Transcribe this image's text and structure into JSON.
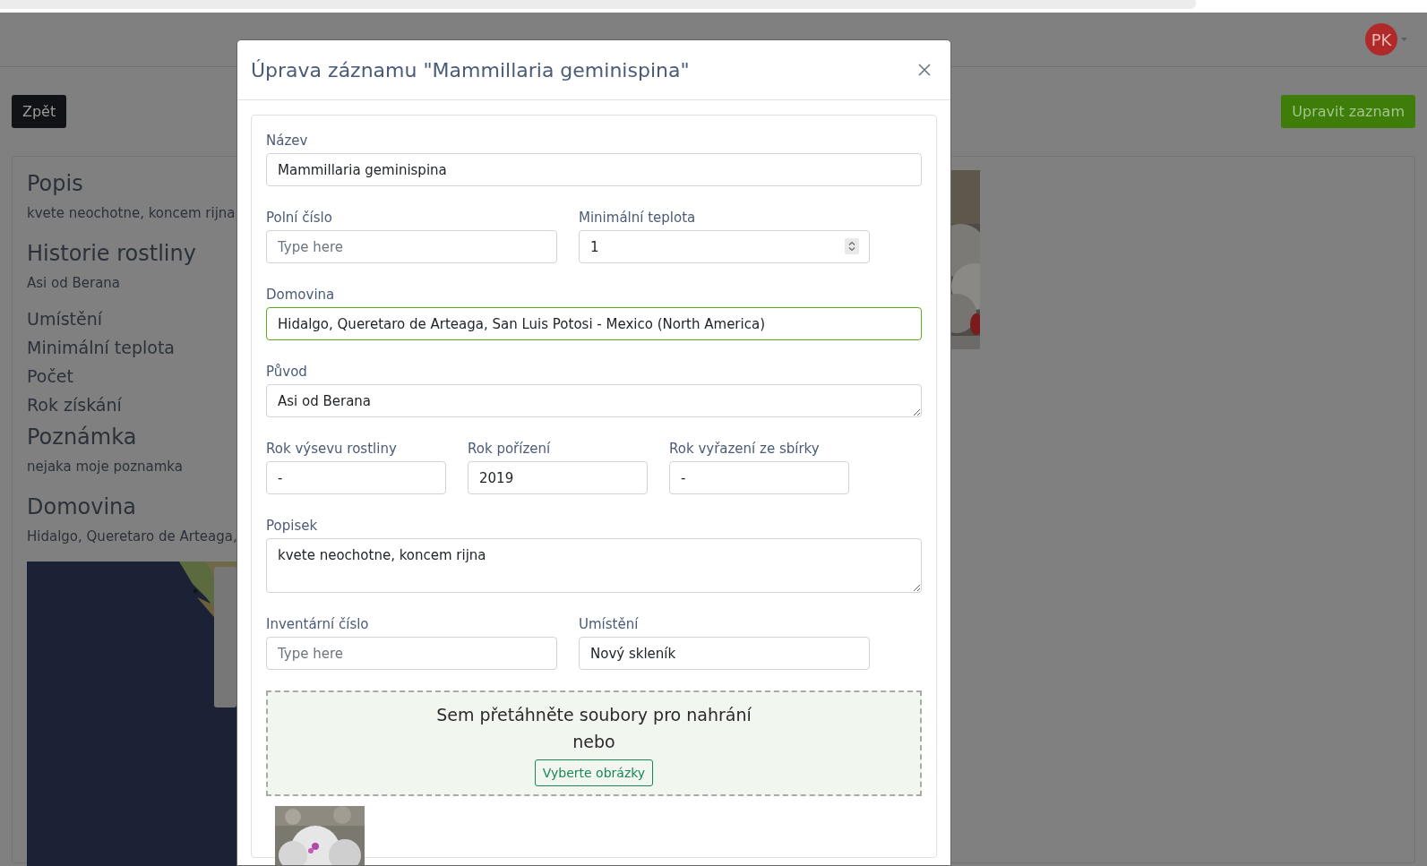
{
  "navbar": {
    "avatar_initials": "PK"
  },
  "back_button": "Zpět",
  "edit_button": "Upravit zaznam",
  "details": [
    {
      "kind": "heading",
      "text": "Popis"
    },
    {
      "kind": "text",
      "text": "kvete neochotne, koncem rijna"
    },
    {
      "kind": "heading",
      "text": "Historie rostliny"
    },
    {
      "kind": "text",
      "text": "Asi od Berana"
    },
    {
      "kind": "label",
      "text": "Umístění"
    },
    {
      "kind": "label",
      "text": "Minimální teplota"
    },
    {
      "kind": "label",
      "text": "Počet"
    },
    {
      "kind": "label",
      "text": "Rok získání"
    },
    {
      "kind": "heading",
      "text": "Poznámka"
    },
    {
      "kind": "text",
      "text": "nejaka moje poznamka"
    },
    {
      "kind": "heading",
      "text": "Domovina"
    },
    {
      "kind": "text",
      "text": "Hidalgo, Queretaro de Arteaga,"
    }
  ],
  "modal": {
    "title": "Úprava záznamu \"Mammillaria geminispina\"",
    "rows": [
      [
        {
          "kind": "text",
          "label": "Název",
          "value": "Mammillaria geminispina",
          "focused": false
        }
      ],
      [
        {
          "kind": "text",
          "label": "Polní číslo",
          "placeholder": "Type here",
          "focused": false
        },
        {
          "kind": "number",
          "label": "Minimální teplota",
          "value": "1",
          "focused": false
        }
      ],
      [
        {
          "kind": "text",
          "label": "Domovina",
          "value": "Hidalgo, Queretaro de Arteaga, San Luis Potosi - Mexico (North America)",
          "focused": true
        }
      ],
      [
        {
          "kind": "textarea",
          "label": "Původ",
          "value": "Asi od Berana",
          "focused": false
        }
      ],
      [
        {
          "kind": "text",
          "label": "Rok výsevu rostliny",
          "value": "-",
          "focused": false
        },
        {
          "kind": "text",
          "label": "Rok pořízení",
          "value": "2019",
          "focused": false
        },
        {
          "kind": "text",
          "label": "Rok vyřazení ze sbírky",
          "value": "-",
          "focused": false
        }
      ],
      [
        {
          "kind": "memo",
          "label": "Popisek",
          "value": "kvete neochotne, koncem rijna",
          "focused": false
        }
      ],
      [
        {
          "kind": "text",
          "label": "Inventární číslo",
          "placeholder": "Type here",
          "focused": false
        },
        {
          "kind": "text",
          "label": "Umístění",
          "value": "Nový skleník",
          "focused": false
        }
      ]
    ],
    "dropzone": {
      "text": "Sem přetáhněte soubory pro nahrání",
      "or_text": "nebo",
      "button": "Vyberte obrázky"
    }
  }
}
